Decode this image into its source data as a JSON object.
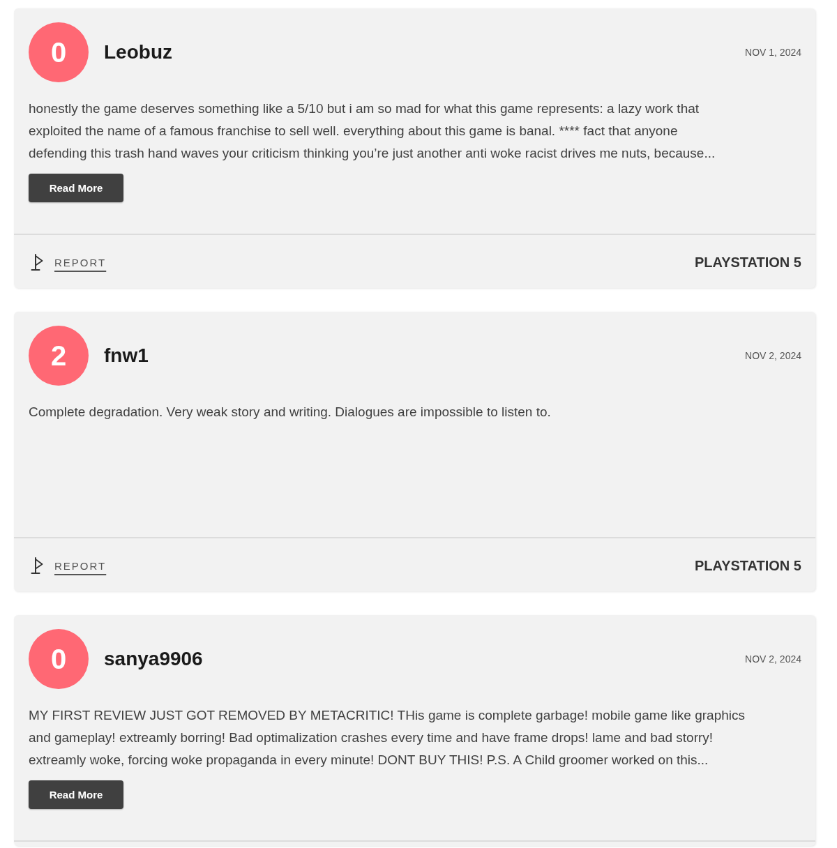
{
  "reviews": [
    {
      "score": "0",
      "username": "Leobuz",
      "date": "NOV 1, 2024",
      "text": "honestly the game deserves something like a 5/10 but i am so mad for what this game represents: a lazy work that\nexploited the name of a famous franchise to sell well. everything about this game is banal. **** fact that anyone\ndefending this trash hand waves your criticism thinking you’re just another anti woke racist drives me nuts, because...",
      "read_more": "Read More",
      "report": "REPORT",
      "platform": "PLAYSTATION 5"
    },
    {
      "score": "2",
      "username": "fnw1",
      "date": "NOV 2, 2024",
      "text": "Complete degradation. Very weak story and writing. Dialogues are impossible to listen to.",
      "report": "REPORT",
      "platform": "PLAYSTATION 5"
    },
    {
      "score": "0",
      "username": "sanya9906",
      "date": "NOV 2, 2024",
      "text": "MY FIRST REVIEW JUST GOT REMOVED BY METACRITIC! THis game is complete garbage! mobile game like graphics\nand gameplay! extreamly borring! Bad optimalization crashes every time and have frame drops! lame and bad storry!\nextreamly woke, forcing woke propaganda in every minute! DONT BUY THIS! P.S. A Child groomer worked on this...",
      "read_more": "Read More"
    }
  ]
}
